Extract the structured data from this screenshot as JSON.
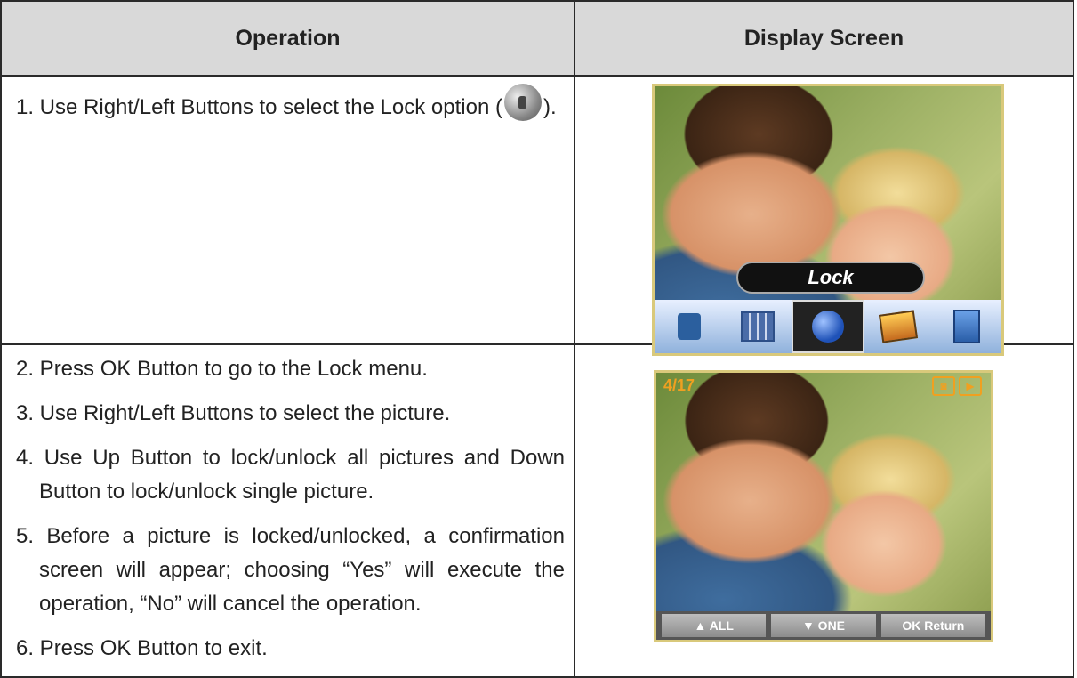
{
  "table": {
    "headers": {
      "operation": "Operation",
      "display": "Display Screen"
    },
    "row1": {
      "step1_before_icon": "1. Use Right/Left Buttons to select the Lock option (",
      "step1_after_icon": ")."
    },
    "row2": {
      "steps": [
        "2. Press OK Button to go to the Lock menu.",
        "3. Use Right/Left Buttons to select the picture.",
        "4. Use Up Button to lock/unlock all pictures and Down Button to lock/unlock single picture.",
        "5. Before a picture is locked/unlocked, a confirmation screen will appear; choosing “Yes” will execute the operation, “No” will cancel the operation.",
        "6. Press OK Button to exit."
      ]
    }
  },
  "screen1": {
    "label": "Lock",
    "icons": [
      "trash-icon",
      "thumbnail-grid-icon",
      "lock-icon",
      "slideshow-icon",
      "exit-icon"
    ],
    "selected_index": 2
  },
  "screen2": {
    "counter": "4/17",
    "softkeys": [
      "▲ ALL",
      "▼ ONE",
      "OK Return"
    ]
  }
}
